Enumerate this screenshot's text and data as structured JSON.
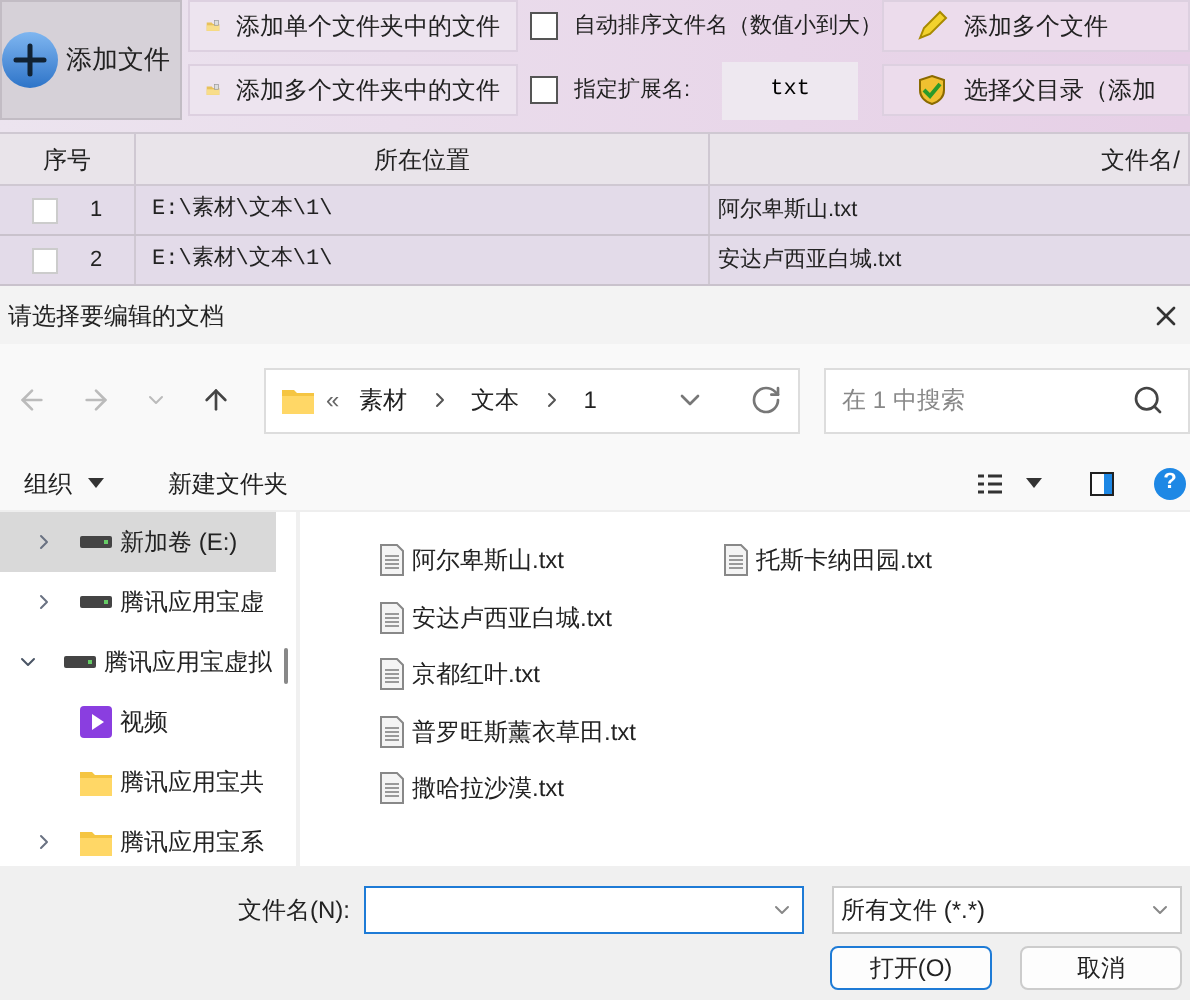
{
  "toolbar": {
    "add_file": "添加文件",
    "buttons": [
      {
        "label": "添加单个文件夹中的文件",
        "kind": "folder"
      },
      {
        "label": "添加多个文件夹中的文件",
        "kind": "folder"
      }
    ],
    "options": [
      {
        "label": "自动排序文件名（数值小到大）",
        "checked": false
      },
      {
        "label": "指定扩展名:",
        "checked": false,
        "value": "txt"
      }
    ],
    "right_buttons": [
      {
        "label": "添加多个文件",
        "kind": "pencil"
      },
      {
        "label": "选择父目录（添加",
        "kind": "shield"
      }
    ]
  },
  "table": {
    "columns": [
      "序号",
      "所在位置",
      "文件名/"
    ],
    "rows": [
      {
        "index": "1",
        "location": "E:\\素材\\文本\\1\\",
        "name": "阿尔卑斯山.txt",
        "checked": false
      },
      {
        "index": "2",
        "location": "E:\\素材\\文本\\1\\",
        "name": "安达卢西亚白城.txt",
        "checked": false
      }
    ]
  },
  "dialog": {
    "title": "请选择要编辑的文档",
    "overflow_mark": "«",
    "help": "?",
    "breadcrumb": [
      "素材",
      "文本",
      "1"
    ],
    "search_placeholder": "在 1 中搜索",
    "organize": "组织",
    "new_folder": "新建文件夹",
    "sidebar": [
      {
        "label": "新加卷 (E:)",
        "kind": "drive",
        "expanded": false,
        "selected": true
      },
      {
        "label": "腾讯应用宝虚",
        "kind": "drive",
        "expanded": false,
        "selected": false
      },
      {
        "label": "腾讯应用宝虚拟",
        "kind": "drive",
        "expanded": true,
        "selected": false,
        "children": [
          {
            "label": "视频",
            "kind": "video",
            "selected": false
          },
          {
            "label": "腾讯应用宝共",
            "kind": "folder",
            "selected": false
          },
          {
            "label": "腾讯应用宝系",
            "kind": "folder",
            "expanded": false,
            "selected": false
          }
        ]
      }
    ],
    "files": [
      "阿尔卑斯山.txt",
      "安达卢西亚白城.txt",
      "京都红叶.txt",
      "普罗旺斯薰衣草田.txt",
      "撒哈拉沙漠.txt",
      "托斯卡纳田园.txt"
    ],
    "filename_label": "文件名(N):",
    "filter": "所有文件 (*.*)",
    "open": "打开(O)",
    "cancel": "取消"
  }
}
